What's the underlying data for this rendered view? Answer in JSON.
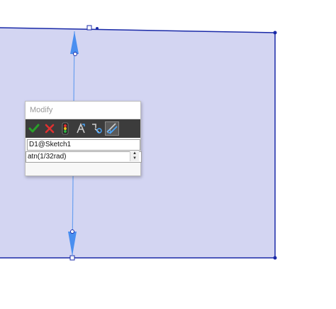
{
  "dialog": {
    "title": "Modify",
    "dimension_name": "D1@Sketch1",
    "value": "atn(1/32rad)"
  },
  "toolbar": {
    "buttons": [
      {
        "icon": "check-icon",
        "color": "#2aa02a"
      },
      {
        "icon": "close-icon",
        "color": "#e03030"
      },
      {
        "icon": "rebuild-icon",
        "color": "#e03030"
      },
      {
        "icon": "reverse-dimension-icon",
        "color": "#cfcfcf"
      },
      {
        "icon": "mark-dimension-icon",
        "color": "#cfcfcf"
      },
      {
        "icon": "smart-dimension-icon",
        "color": "#4aa8ff"
      }
    ]
  },
  "sketch": {
    "fill_color": "#d3d5f2",
    "line_color": "#1a2aa8",
    "dimension_color": "#6aa0f0"
  }
}
